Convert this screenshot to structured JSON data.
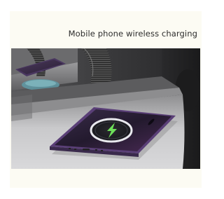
{
  "caption": "Mobile phone wireless charging",
  "icons": {
    "charging": "lightning-bolt-icon",
    "ring": "magsafe-charging-ring"
  },
  "colors": {
    "background": "#fcfbf3",
    "phone_frame": "#5a3f77",
    "ring": "#e9e9ee",
    "bolt": "#6ee05a",
    "charger_pad": "#5f9aa6"
  }
}
